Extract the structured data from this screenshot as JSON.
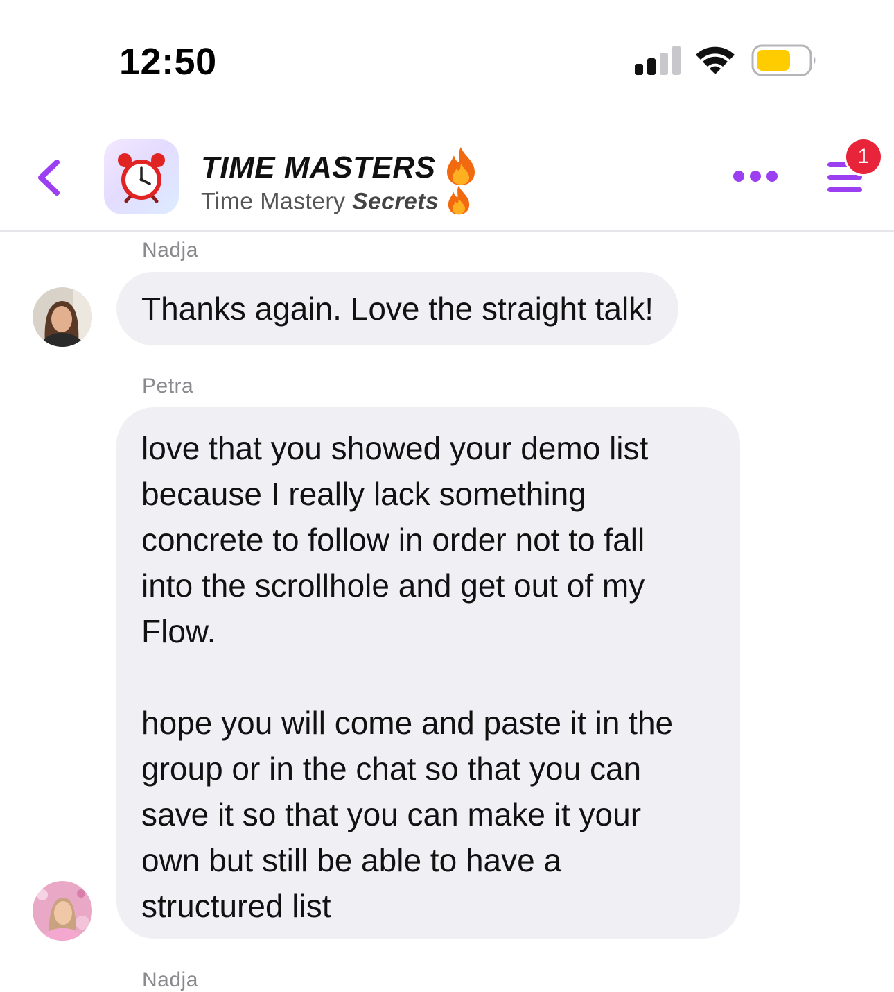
{
  "status_bar": {
    "time": "12:50",
    "battery_color": "#ffcc00"
  },
  "header": {
    "back_icon": "chevron-left-icon",
    "group_icon": "alarm-clock-icon",
    "title": "TIME MASTERS",
    "title_emoji": "fire-icon",
    "subtitle_plain": "Time Mastery ",
    "subtitle_emphasis": "Secrets",
    "subtitle_emoji": "fire-icon",
    "more_icon": "more-horizontal-icon",
    "menu_icon": "menu-icon",
    "notification_badge": "1",
    "accent_color": "#9b3ff0"
  },
  "messages": [
    {
      "sender": "Nadja",
      "lines": [
        "Thanks again. Love the straight talk!"
      ]
    },
    {
      "sender": "Petra",
      "lines": [
        "love that you showed your demo list",
        "because I really lack something",
        "concrete to follow in order not to fall",
        "into the scrollhole and get out of my",
        "Flow.",
        "",
        "hope you will come and paste it in the",
        "group or in the chat so that you can",
        "save it so that you can make it your",
        "own but still be able to have a",
        "structured list"
      ]
    },
    {
      "sender": "Nadja",
      "lines": []
    }
  ]
}
